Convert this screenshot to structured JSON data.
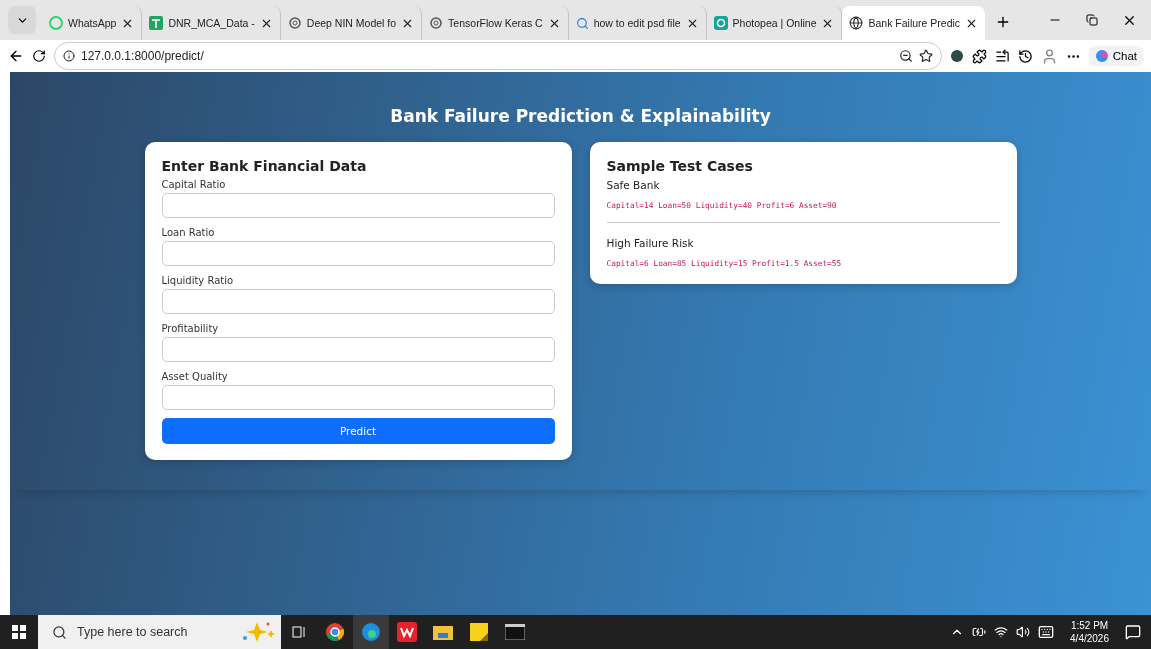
{
  "browser": {
    "tabs": [
      {
        "title": "WhatsApp",
        "kind": "whatsapp",
        "selected": false
      },
      {
        "title": "DNR_MCA_Data -",
        "kind": "sheet",
        "selected": false
      },
      {
        "title": "Deep NIN Model fo",
        "kind": "chatbot",
        "selected": false
      },
      {
        "title": "TensorFlow Keras C",
        "kind": "chatbot",
        "selected": false
      },
      {
        "title": "how to edit psd file",
        "kind": "search",
        "selected": false
      },
      {
        "title": "Photopea | Online",
        "kind": "photopea",
        "selected": false
      },
      {
        "title": "Bank Failure Predic",
        "kind": "globe",
        "selected": true
      }
    ],
    "address": "127.0.0.1:8000/predict/",
    "chat_label": "Chat"
  },
  "page": {
    "title": "Bank Failure Prediction & Explainability",
    "form": {
      "title": "Enter Bank Financial Data",
      "fields": [
        {
          "label": "Capital Ratio"
        },
        {
          "label": "Loan Ratio"
        },
        {
          "label": "Liquidity Ratio"
        },
        {
          "label": "Profitability"
        },
        {
          "label": "Asset Quality"
        }
      ],
      "button": "Predict"
    },
    "samples": {
      "title": "Sample Test Cases",
      "cases": [
        {
          "name": "Safe Bank",
          "values": "Capital=14 Loan=50 Liquidity=40 Profit=6 Asset=90"
        },
        {
          "name": "High Failure Risk",
          "values": "Capital=6 Loan=85 Liquidity=15 Profit=1.5 Asset=55"
        }
      ]
    }
  },
  "taskbar": {
    "search_placeholder": "Type here to search",
    "time": "1:52 PM",
    "date": "4/4/2026"
  }
}
